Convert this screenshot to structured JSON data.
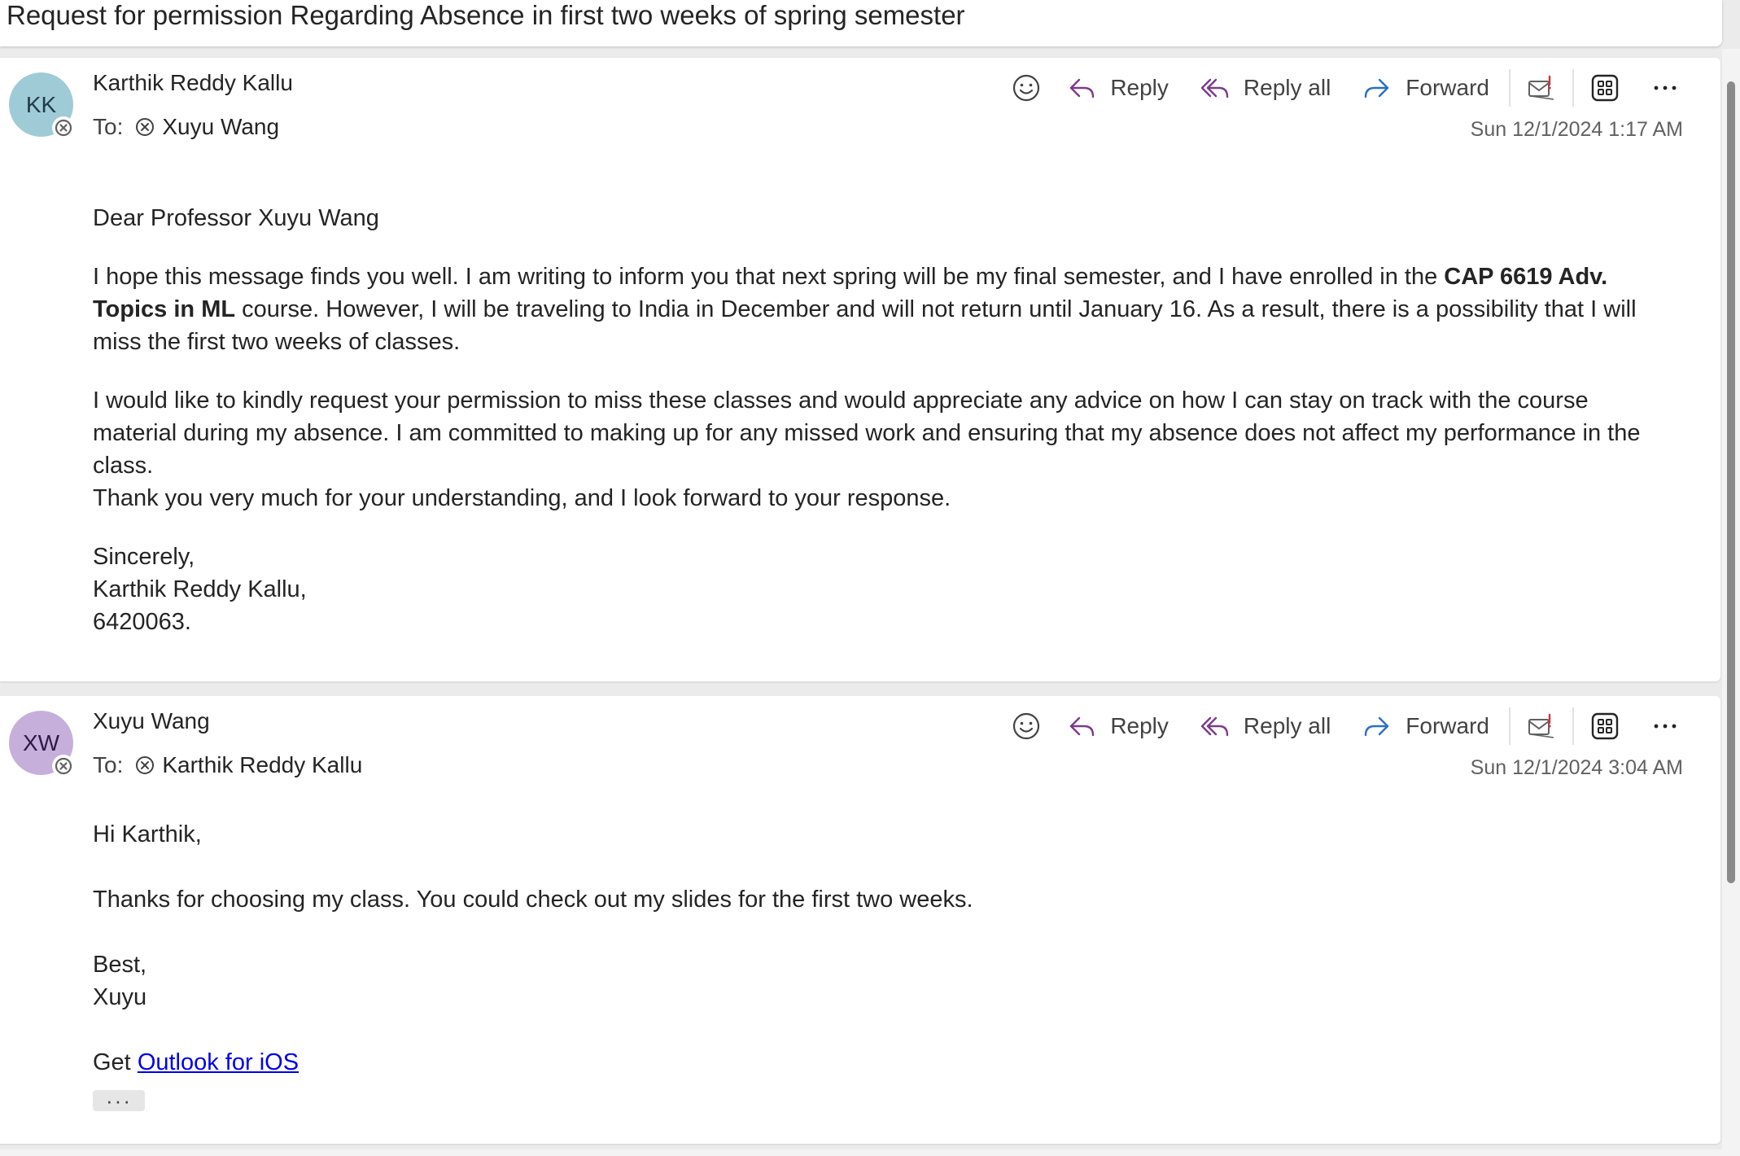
{
  "subject": "Request for permission Regarding Absence in first two weeks of spring semester",
  "toolbar": {
    "reply_label": "Reply",
    "reply_all_label": "Reply all",
    "forward_label": "Forward"
  },
  "messages": [
    {
      "avatar_initials": "KK",
      "avatar_color": "#9fcbd6",
      "sender": "Karthik Reddy Kallu",
      "to_label": "To:",
      "recipient": "Xuyu Wang",
      "timestamp": "Sun 12/1/2024 1:17 AM",
      "body": {
        "greeting": "Dear Professor Xuyu Wang",
        "p1_before": "I hope this message finds you well. I am writing to inform you that next spring will be my final semester, and I have enrolled in the ",
        "p1_bold": "CAP 6619 Adv. Topics in ML",
        "p1_after": " course. However, I will be traveling to India in December and will not return until January 16. As a result, there is a possibility that I will miss the first two weeks of classes.",
        "p2": "I would like to kindly request your permission to miss these classes and would appreciate any advice on how I can stay on track with the course material during my absence. I am committed to making up for any missed work and ensuring that my absence does not affect my performance in the class.",
        "p3": "Thank you very much for your understanding, and I look forward to your response.",
        "closing": "Sincerely,",
        "sig_name": "Karthik Reddy Kallu,",
        "sig_id": "6420063."
      }
    },
    {
      "avatar_initials": "XW",
      "avatar_color": "#c7afdc",
      "sender": "Xuyu Wang",
      "to_label": "To:",
      "recipient": "Karthik Reddy Kallu",
      "timestamp": "Sun 12/1/2024 3:04 AM",
      "body": {
        "greeting": "Hi Karthik,",
        "p1": "Thanks for choosing my class. You could check out my slides for the first two weeks.",
        "closing": "Best,",
        "sig_name": "Xuyu",
        "get_prefix": "Get ",
        "link_text": "Outlook for iOS",
        "more_dots": "···"
      }
    }
  ],
  "icons": {
    "emoji": "smiley-icon",
    "reply": "reply-arrow-icon",
    "reply_all": "reply-all-arrow-icon",
    "forward": "forward-arrow-icon",
    "report": "report-mail-icon",
    "apps": "apps-grid-icon",
    "more": "more-ellipsis-icon",
    "presence": "presence-blocked-icon"
  },
  "colors": {
    "reply_icon": "#7c3a8c",
    "forward_icon": "#2a6fc6",
    "link": "#0000ee",
    "report_icon_accent": "#d13438"
  }
}
